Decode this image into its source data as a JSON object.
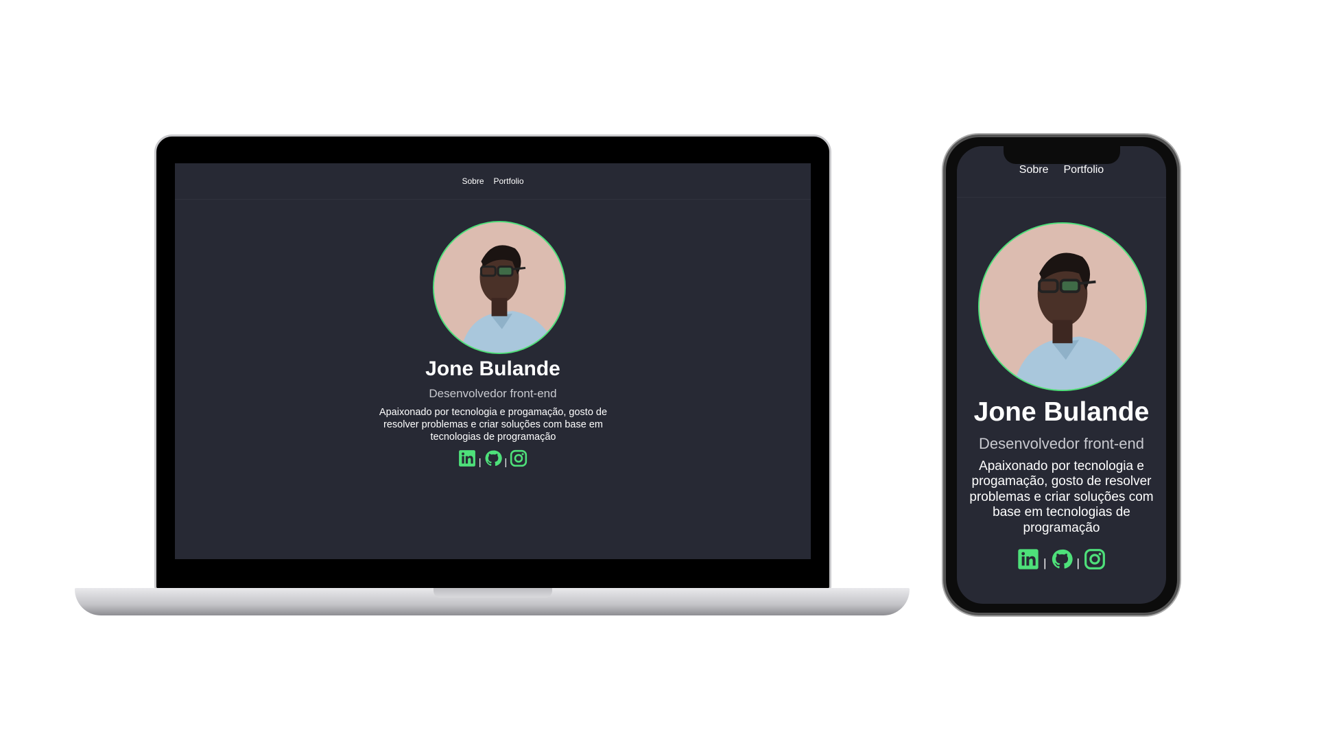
{
  "nav": {
    "items": [
      "Sobre",
      "Portfolio"
    ]
  },
  "profile": {
    "name": "Jone Bulande",
    "role": "Desenvolvedor front-end",
    "bio": "Apaixonado por tecnologia e progamação, gosto de resolver problemas e criar soluções com base em tecnologias de programação"
  },
  "socials": {
    "icons": [
      "linkedin-icon",
      "github-icon",
      "instagram-icon"
    ],
    "separator": "|"
  },
  "colors": {
    "background": "#272934",
    "accent": "#4ee07a"
  }
}
